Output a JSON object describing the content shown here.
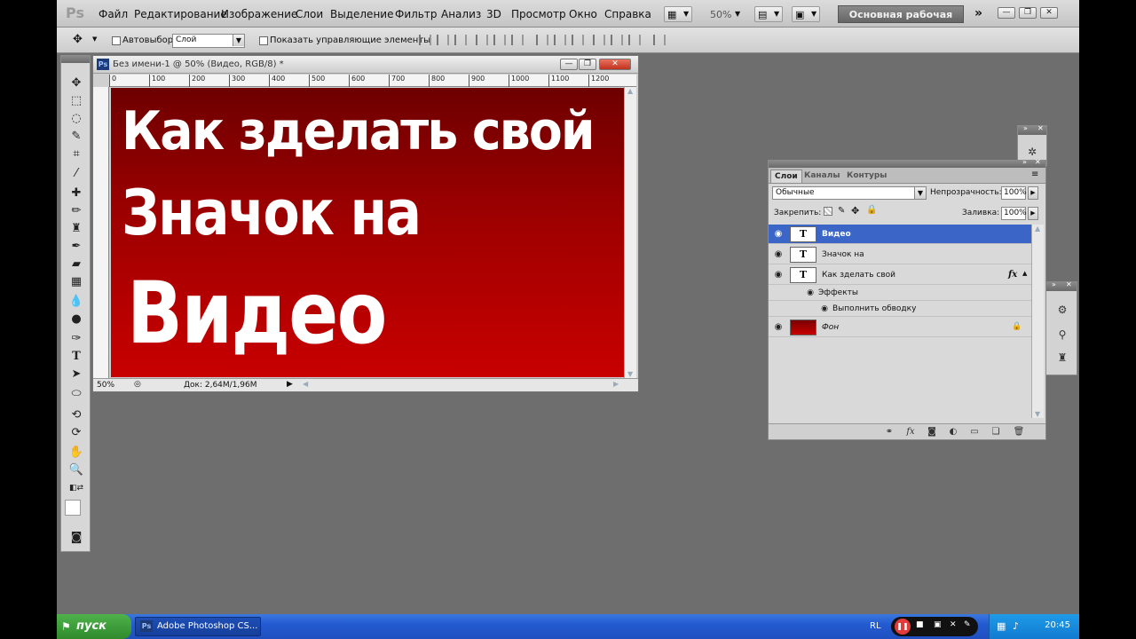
{
  "menubar": {
    "logo": "Ps",
    "items": [
      "Файл",
      "Редактирование",
      "Изображение",
      "Слои",
      "Выделение",
      "Фильтр",
      "Анализ",
      "3D",
      "Просмотр",
      "Окно",
      "Справка"
    ],
    "zoom": "50%",
    "workspace_label": "Основная рабочая среда"
  },
  "options_bar": {
    "autoselect_label": "Автовыбор:",
    "autoselect_value": "Слой",
    "show_controls_label": "Показать управляющие элементы"
  },
  "document": {
    "title": "Без имени-1 @ 50% (Видео, RGB/8) *",
    "ruler_ticks": [
      "0",
      "100",
      "200",
      "300",
      "400",
      "500",
      "600",
      "700",
      "800",
      "900",
      "1000",
      "1100",
      "1200"
    ],
    "canvas_lines": [
      "Как зделать свой",
      "Значок на",
      "Видео"
    ],
    "status_zoom": "50%",
    "status_doc": "Док: 2,64M/1,96M"
  },
  "layers_panel": {
    "tabs": [
      "Слои",
      "Каналы",
      "Контуры"
    ],
    "blend_mode": "Обычные",
    "opacity_label": "Непрозрачность:",
    "opacity_value": "100%",
    "lock_label": "Закрепить:",
    "fill_label": "Заливка:",
    "fill_value": "100%",
    "layers": [
      {
        "name": "Видео",
        "type": "text",
        "selected": true
      },
      {
        "name": "Значок на",
        "type": "text",
        "selected": false
      },
      {
        "name": "Как зделать свой",
        "type": "text",
        "selected": false,
        "fx": "fx"
      },
      {
        "name": "Эффекты",
        "type": "effects-group"
      },
      {
        "name": "Выполнить обводку",
        "type": "effect"
      },
      {
        "name": "Фон",
        "type": "background",
        "thumb_color": "#c00000"
      }
    ]
  },
  "taskbar": {
    "start_label": "пуск",
    "task_label": "Adobe Photoshop CS...",
    "lang": "RL",
    "clock": "20:45"
  },
  "colors": {
    "canvas_top": "#6e0000",
    "canvas_bottom": "#c80000",
    "selection_blue": "#3b66c7",
    "workspace_gray": "#6e6e6e"
  }
}
